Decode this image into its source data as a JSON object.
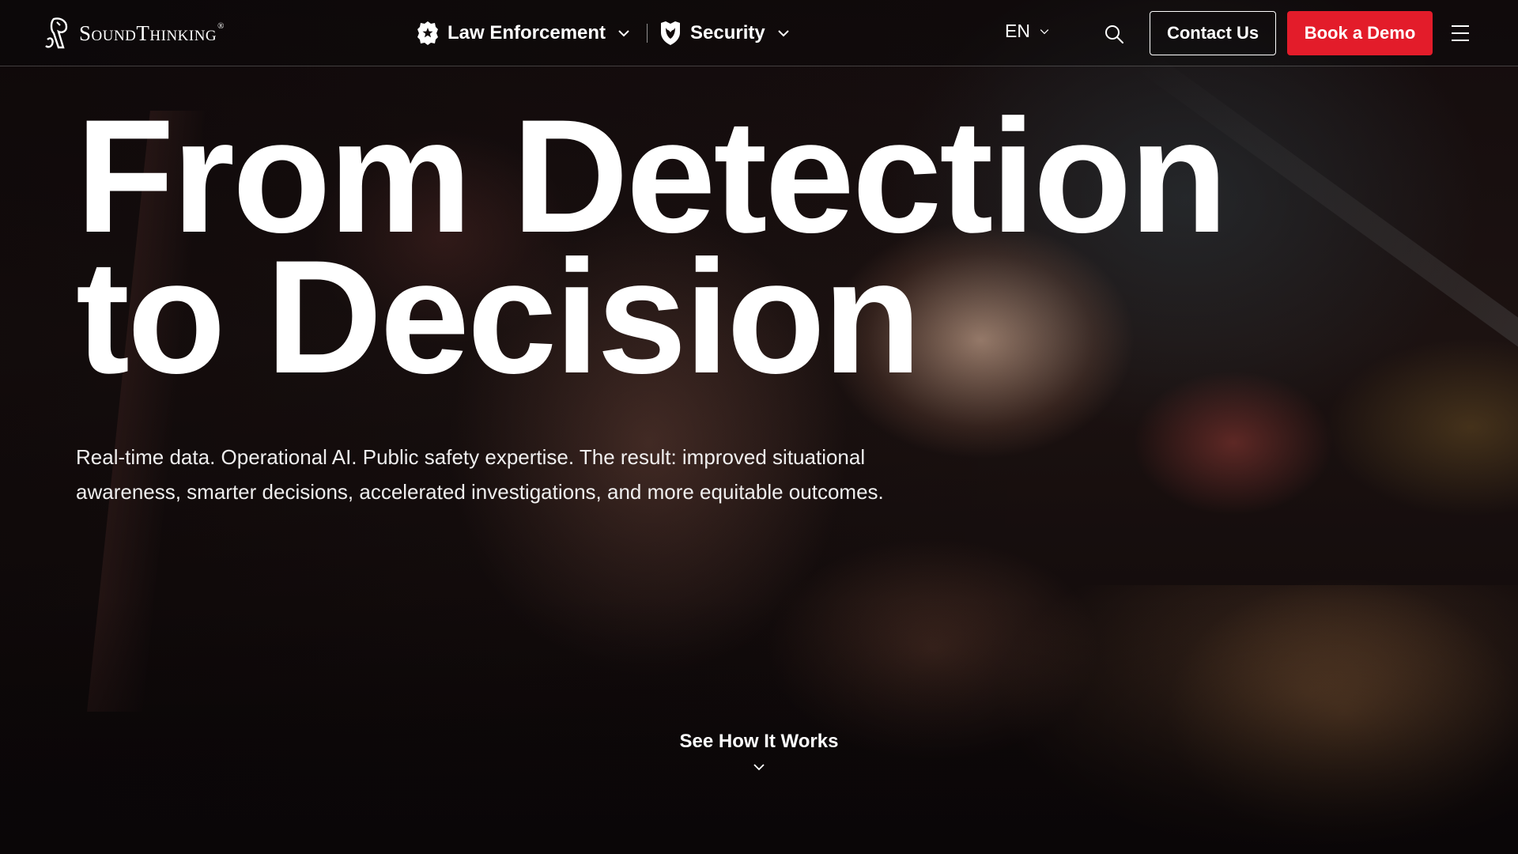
{
  "header": {
    "logo_text": "SoundThinking",
    "logo_reg": "®",
    "nav": [
      {
        "label": "Law Enforcement",
        "icon": "police-badge-icon"
      },
      {
        "label": "Security",
        "icon": "shield-icon"
      }
    ],
    "language": "EN",
    "search_icon": "search-icon",
    "contact_label": "Contact Us",
    "demo_label": "Book a Demo",
    "menu_icon": "hamburger-menu-icon"
  },
  "hero": {
    "title_line1": "From Detection",
    "title_line2": "to Decision",
    "subtitle": "Real-time data. Operational AI. Public safety expertise. The result: improved situational awareness, smarter decisions, accelerated investigations, and more equitable outcomes.",
    "cta_label": "See How It Works"
  },
  "colors": {
    "accent": "#e31c2a",
    "text": "#ffffff",
    "background": "#0b0708"
  }
}
